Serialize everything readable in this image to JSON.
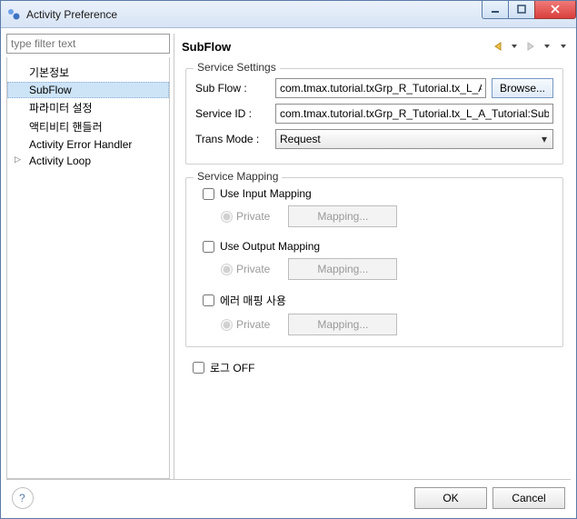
{
  "window": {
    "title": "Activity Preference"
  },
  "filter": {
    "placeholder": "type filter text"
  },
  "tree": {
    "items": [
      {
        "label": "기본정보",
        "selected": false,
        "arrow": false
      },
      {
        "label": "SubFlow",
        "selected": true,
        "arrow": false
      },
      {
        "label": "파라미터 설정",
        "selected": false,
        "arrow": false
      },
      {
        "label": "액티비티 핸들러",
        "selected": false,
        "arrow": false
      },
      {
        "label": "Activity Error Handler",
        "selected": false,
        "arrow": false
      },
      {
        "label": "Activity Loop",
        "selected": false,
        "arrow": true
      }
    ]
  },
  "page": {
    "title": "SubFlow"
  },
  "service_settings": {
    "legend": "Service Settings",
    "subflow_label": "Sub Flow :",
    "subflow_value": "com.tmax.tutorial.txGrp_R_Tutorial.tx_L_A_T",
    "browse_label": "Browse...",
    "serviceid_label": "Service ID :",
    "serviceid_value": "com.tmax.tutorial.txGrp_R_Tutorial.tx_L_A_Tutorial:SubF",
    "transmode_label": "Trans Mode :",
    "transmode_value": "Request"
  },
  "service_mapping": {
    "legend": "Service Mapping",
    "input": {
      "check_label": "Use Input Mapping",
      "private_label": "Private",
      "button": "Mapping..."
    },
    "output": {
      "check_label": "Use Output Mapping",
      "private_label": "Private",
      "button": "Mapping..."
    },
    "error": {
      "check_label": "에러 매핑 사용",
      "private_label": "Private",
      "button": "Mapping..."
    }
  },
  "logoff": {
    "label": "로그 OFF"
  },
  "footer": {
    "ok": "OK",
    "cancel": "Cancel"
  }
}
